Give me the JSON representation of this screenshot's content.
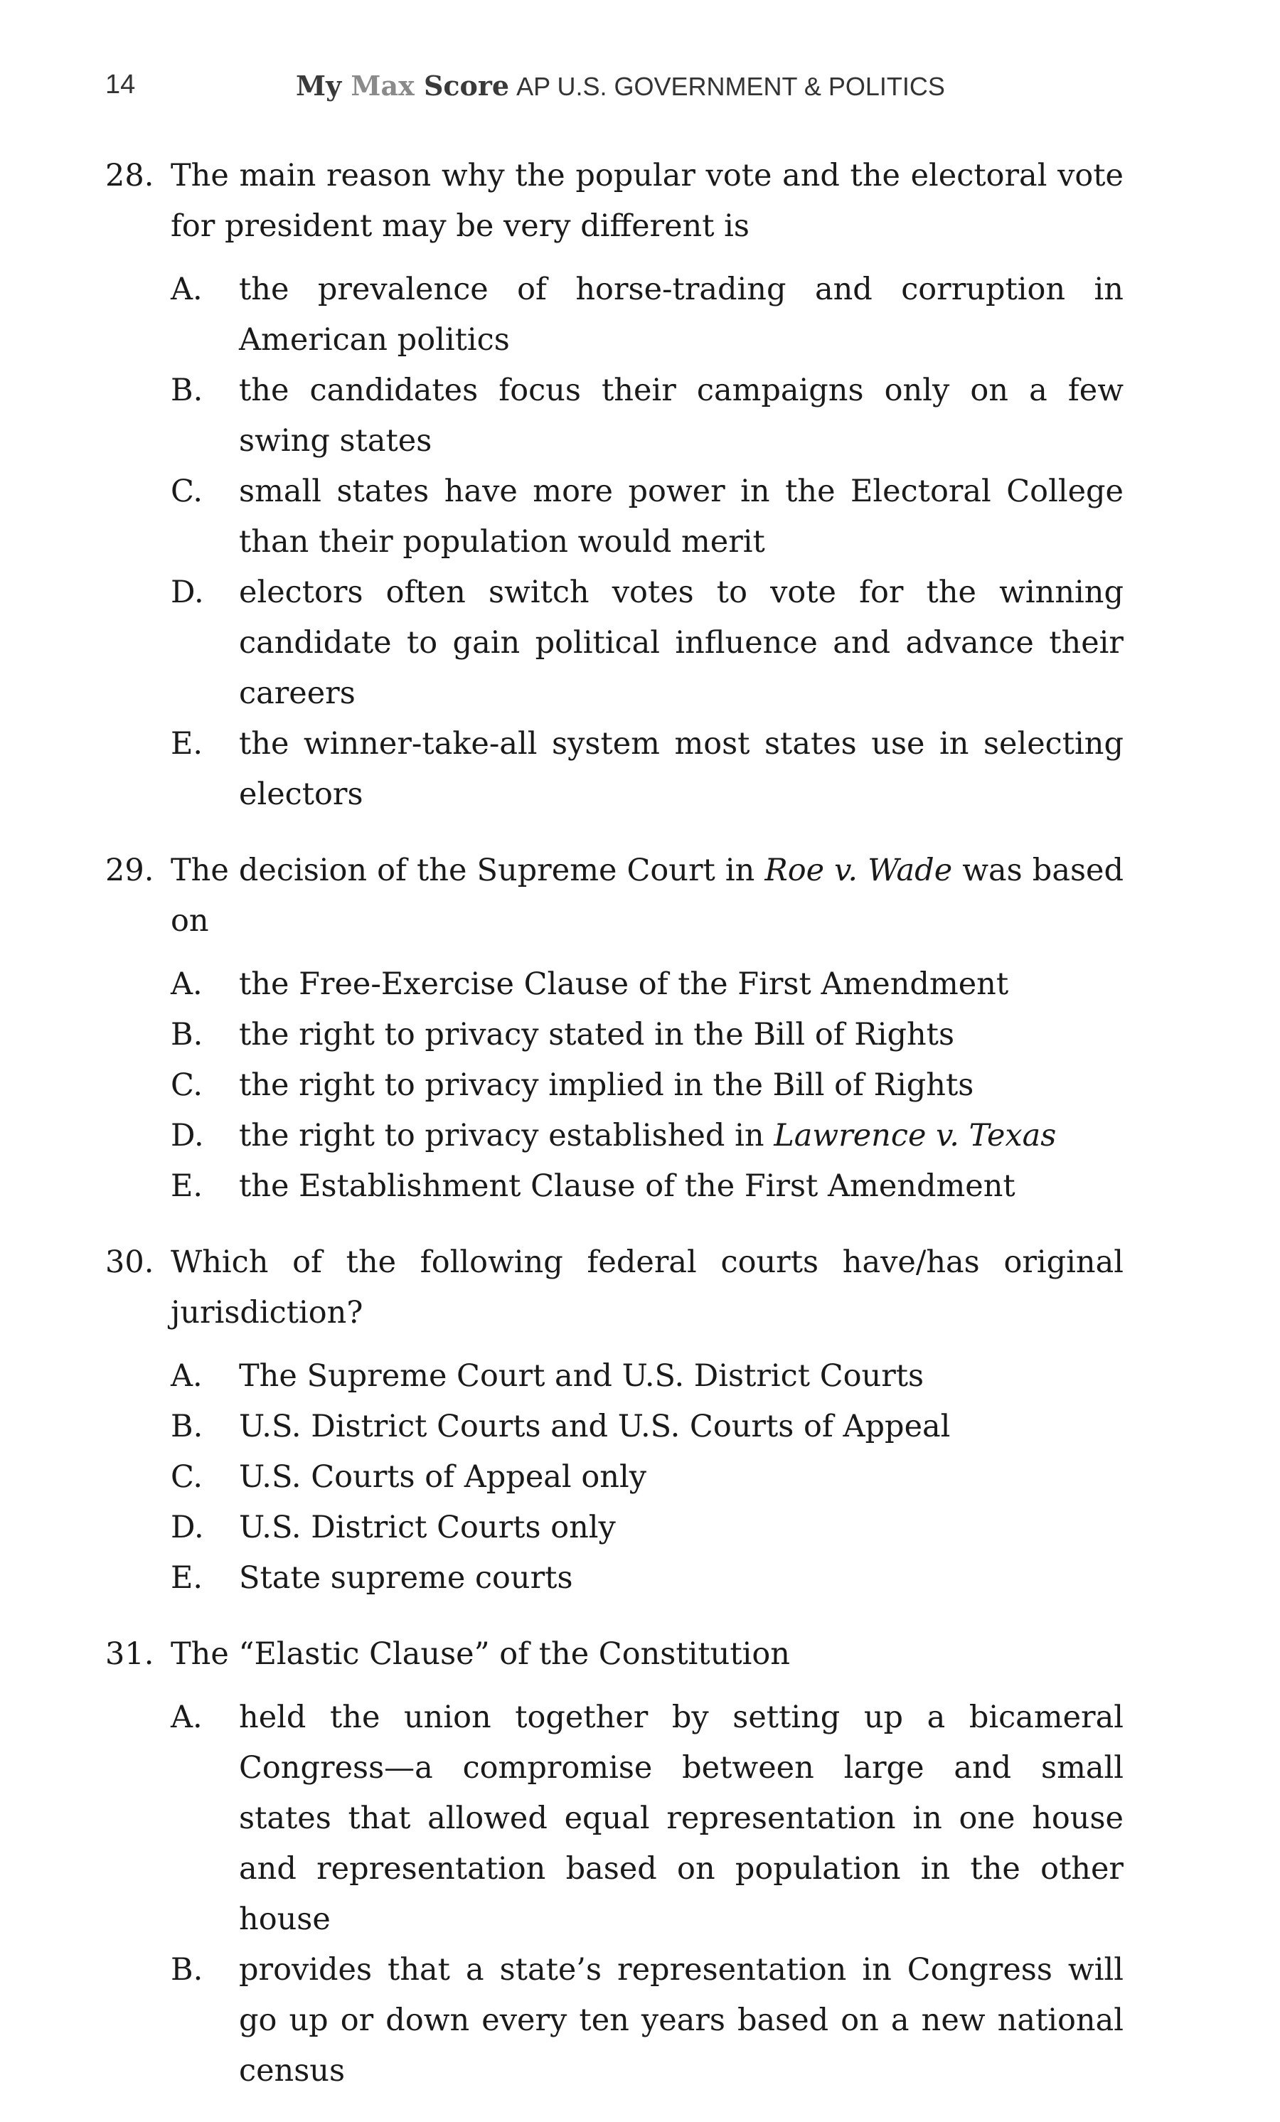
{
  "header": {
    "page_number": "14",
    "brand_my": "My",
    "brand_max": "Max",
    "brand_score": "Score",
    "book_title": "AP U.S. GOVERNMENT & POLITICS"
  },
  "questions": [
    {
      "number": "28.",
      "stem": "The main reason why the popular vote and the electoral vote for president may be very different is",
      "options": [
        {
          "letter": "A.",
          "text": "the prevalence of horse-trading and corruption in American politics"
        },
        {
          "letter": "B.",
          "text": "the candidates focus their campaigns only on a few swing states"
        },
        {
          "letter": "C.",
          "text": "small states have more power in the Electoral College than their population would merit"
        },
        {
          "letter": "D.",
          "text": "electors often switch votes to vote for the winning candidate to gain political influence and advance their careers"
        },
        {
          "letter": "E.",
          "text": "the winner-take-all system most states use in selecting electors"
        }
      ]
    },
    {
      "number": "29.",
      "stem_before": "The decision of the Supreme Court in ",
      "stem_italic": "Roe v. Wade",
      "stem_after": " was based on",
      "options": [
        {
          "letter": "A.",
          "text": "the Free-Exercise Clause of the First Amendment"
        },
        {
          "letter": "B.",
          "text": "the right to privacy stated in the Bill of Rights"
        },
        {
          "letter": "C.",
          "text": "the right to privacy implied in the Bill of Rights"
        },
        {
          "letter": "D.",
          "text_before": "the right to privacy established in ",
          "text_italic": "Lawrence v. Texas"
        },
        {
          "letter": "E.",
          "text": "the Establishment Clause of the First Amendment"
        }
      ]
    },
    {
      "number": "30.",
      "stem": "Which of the following federal courts have/has original jurisdiction?",
      "options": [
        {
          "letter": "A.",
          "text": "The Supreme Court and U.S. District Courts"
        },
        {
          "letter": "B.",
          "text": "U.S. District Courts and U.S. Courts of Appeal"
        },
        {
          "letter": "C.",
          "text": "U.S. Courts of Appeal only"
        },
        {
          "letter": "D.",
          "text": "U.S. District Courts only"
        },
        {
          "letter": "E.",
          "text": "State supreme courts"
        }
      ]
    },
    {
      "number": "31.",
      "stem": "The “Elastic Clause” of the Constitution",
      "options": [
        {
          "letter": "A.",
          "text": "held the union together by setting up a bicameral Congress—a compromise between large and small states that allowed equal representation in one house and representation based on popu­lation in the other house"
        },
        {
          "letter": "B.",
          "text": "provides that a state’s representation in Congress will go up or down every ten years based on a new national census"
        }
      ]
    }
  ]
}
